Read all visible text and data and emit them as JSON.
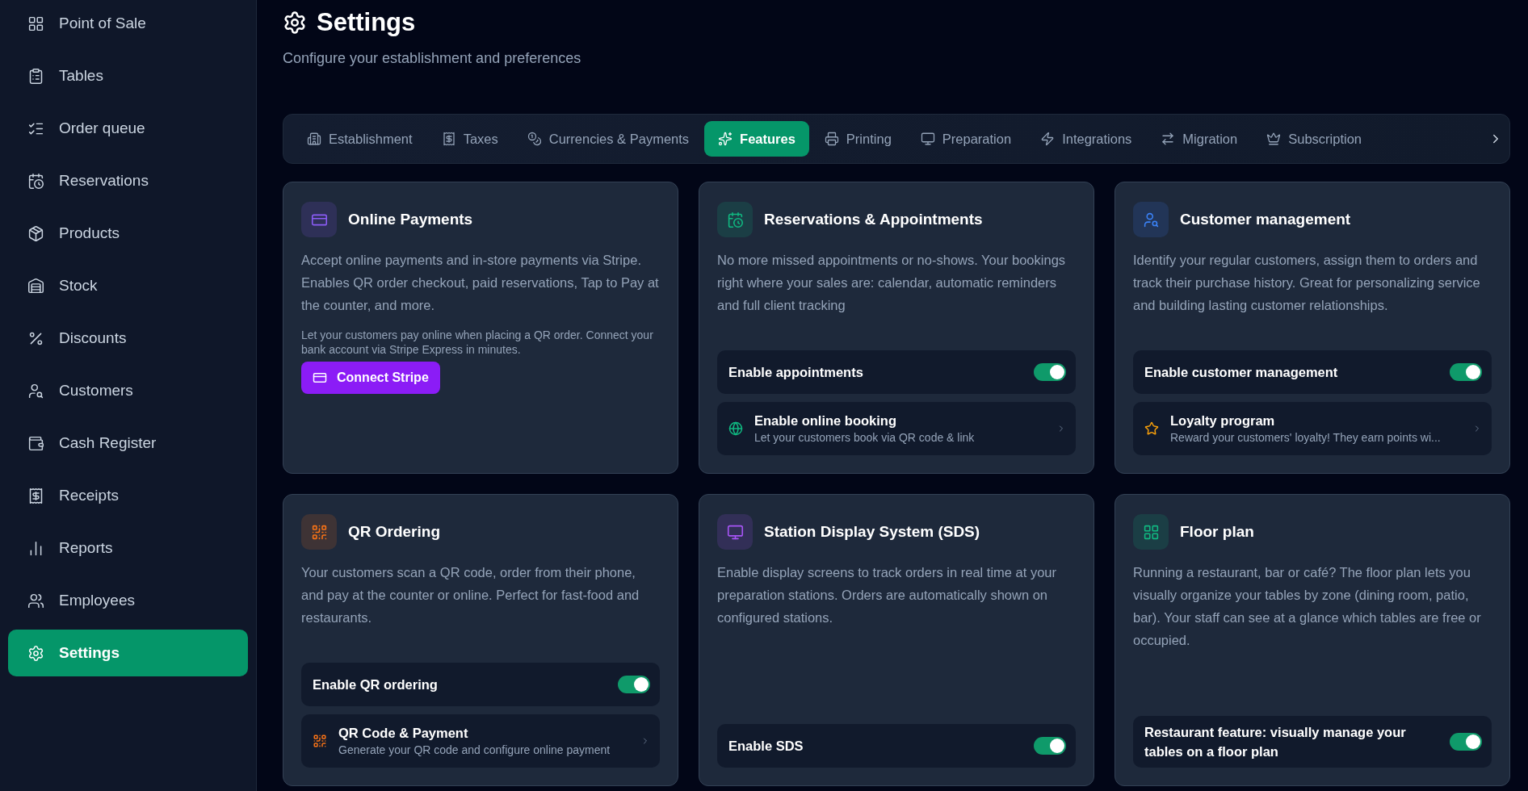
{
  "sidebar": {
    "items": [
      {
        "label": "Point of Sale",
        "selected": false
      },
      {
        "label": "Tables",
        "selected": false
      },
      {
        "label": "Order queue",
        "selected": false
      },
      {
        "label": "Reservations",
        "selected": false
      },
      {
        "label": "Products",
        "selected": false
      },
      {
        "label": "Stock",
        "selected": false
      },
      {
        "label": "Discounts",
        "selected": false
      },
      {
        "label": "Customers",
        "selected": false
      },
      {
        "label": "Cash Register",
        "selected": false
      },
      {
        "label": "Receipts",
        "selected": false
      },
      {
        "label": "Reports",
        "selected": false
      },
      {
        "label": "Employees",
        "selected": false
      },
      {
        "label": "Settings",
        "selected": true
      }
    ]
  },
  "header": {
    "title": "Settings",
    "subtitle": "Configure your establishment and preferences"
  },
  "tabs": [
    {
      "label": "Establishment",
      "selected": false
    },
    {
      "label": "Taxes",
      "selected": false
    },
    {
      "label": "Currencies & Payments",
      "selected": false
    },
    {
      "label": "Features",
      "selected": true
    },
    {
      "label": "Printing",
      "selected": false
    },
    {
      "label": "Preparation",
      "selected": false
    },
    {
      "label": "Integrations",
      "selected": false
    },
    {
      "label": "Migration",
      "selected": false
    },
    {
      "label": "Subscription",
      "selected": false
    }
  ],
  "cards": [
    {
      "title": "Online Payments",
      "color": "#8b5cf6",
      "description": "Accept online payments and in-store payments via Stripe. Enables QR order checkout, paid reservations, Tap to Pay at the counter, and more.",
      "note": "Let your customers pay online when placing a QR order. Connect your bank account via Stripe Express in minutes.",
      "button": "Connect Stripe"
    },
    {
      "title": "Reservations & Appointments",
      "color": "#10b981",
      "description": "No more missed appointments or no-shows. Your bookings right where your sales are: calendar, automatic reminders and full client tracking",
      "rows": [
        {
          "kind": "toggle",
          "label": "Enable appointments",
          "on": true
        },
        {
          "kind": "link",
          "label": "Enable online booking",
          "sublabel": "Let your customers book via QR code & link"
        }
      ]
    },
    {
      "title": "Customer management",
      "color": "#3b82f6",
      "description": "Identify your regular customers, assign them to orders and track their purchase history. Great for personalizing service and building lasting customer relationships.",
      "rows": [
        {
          "kind": "toggle",
          "label": "Enable customer management",
          "on": true
        },
        {
          "kind": "link",
          "label": "Loyalty program",
          "sublabel": "Reward your customers' loyalty! They earn points wi..."
        }
      ]
    },
    {
      "title": "QR Ordering",
      "color": "#f97316",
      "description": "Your customers scan a QR code, order from their phone, and pay at the counter or online. Perfect for fast-food and restaurants.",
      "rows": [
        {
          "kind": "toggle",
          "label": "Enable QR ordering",
          "on": true
        },
        {
          "kind": "link",
          "label": "QR Code & Payment",
          "sublabel": "Generate your QR code and configure online payment"
        }
      ]
    },
    {
      "title": "Station Display System (SDS)",
      "color": "#a855f7",
      "description": "Enable display screens to track orders in real time at your preparation stations. Orders are automatically shown on configured stations.",
      "rows": [
        {
          "kind": "toggle",
          "label": "Enable SDS",
          "on": true
        }
      ]
    },
    {
      "title": "Floor plan",
      "color": "#10b981",
      "description": "Running a restaurant, bar or café? The floor plan lets you visually organize your tables by zone (dining room, patio, bar). Your staff can see at a glance which tables are free or occupied.",
      "rows": [
        {
          "kind": "toggle",
          "label": "Restaurant feature: visually manage your tables on a floor plan",
          "on": true
        }
      ]
    }
  ]
}
